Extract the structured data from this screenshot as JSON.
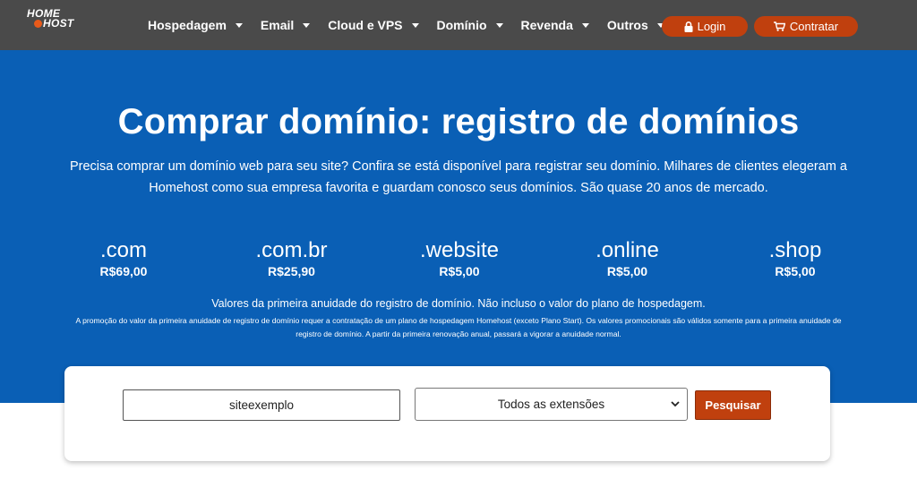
{
  "nav": {
    "logo_top": "HOME",
    "logo_bottom": "HOST",
    "menu": [
      {
        "label": "Hospedagem"
      },
      {
        "label": "Email"
      },
      {
        "label": "Cloud e VPS"
      },
      {
        "label": "Domínio"
      },
      {
        "label": "Revenda"
      },
      {
        "label": "Outros"
      }
    ],
    "login_label": "Login",
    "contratar_label": "Contratar"
  },
  "hero": {
    "title": "Comprar domínio: registro de domínios",
    "lead": "Precisa comprar um domínio web para seu site? Confira se está disponível para registrar seu domínio. Milhares de clientes elegeram a Homehost como sua empresa favorita e guardam conosco seus domínios. São quase 20 anos de mercado.",
    "tlds": [
      {
        "name": ".com",
        "price": "R$69,00"
      },
      {
        "name": ".com.br",
        "price": "R$25,90"
      },
      {
        "name": ".website",
        "price": "R$5,00"
      },
      {
        "name": ".online",
        "price": "R$5,00"
      },
      {
        "name": ".shop",
        "price": "R$5,00"
      }
    ],
    "note": "Valores da primeira anuidade do registro de domínio. Não incluso o valor do plano de hospedagem.",
    "fine_print": "A promoção do valor da primeira anuidade de registro de domínio requer a contratação de um plano de hospedagem Homehost (exceto Plano Start). Os valores promocionais são válidos somente para a primeira anuidade de registro de domínio. A partir da primeira renovação anual, passará a vigorar a anuidade normal."
  },
  "search": {
    "value": "siteexemplo",
    "select_value": "Todos as extensões",
    "button_label": "Pesquisar"
  },
  "colors": {
    "nav_bg": "#4a4a4a",
    "hero_bg": "#0a5fb5",
    "accent": "#c0400e"
  }
}
